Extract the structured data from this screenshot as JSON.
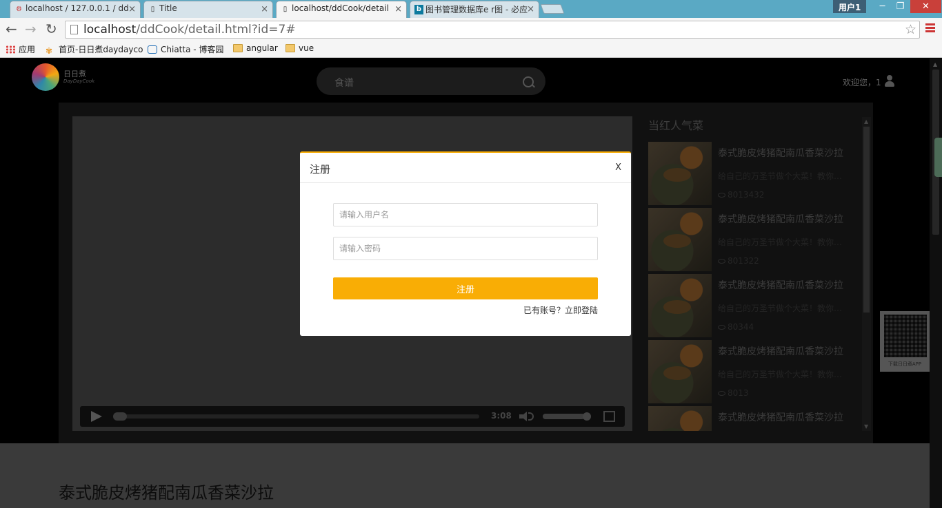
{
  "browser": {
    "tabs": [
      {
        "title": "localhost / 127.0.0.1 / dd",
        "icon": "phpmyadmin-icon"
      },
      {
        "title": "Title",
        "icon": "page-icon"
      },
      {
        "title": "localhost/ddCook/detail",
        "icon": "page-icon",
        "active": true
      },
      {
        "title": "图书管理数据库e r图 - 必应",
        "icon": "bing-icon"
      }
    ],
    "user_badge": "用户1",
    "url_host": "localhost",
    "url_path": "/ddCook/detail.html?id=7#",
    "bookmarks": [
      {
        "label": "应用",
        "icon": "apps-icon"
      },
      {
        "label": "首页-日日煮daydayco",
        "icon": "site-icon"
      },
      {
        "label": "Chiatta - 博客园",
        "icon": "site-icon"
      },
      {
        "label": "angular",
        "icon": "folder-icon"
      },
      {
        "label": "vue",
        "icon": "folder-icon"
      }
    ]
  },
  "header": {
    "logo_title": "日日煮",
    "logo_subtitle": "DayDayCook",
    "search_placeholder": "食谱",
    "welcome": "欢迎您，1"
  },
  "video": {
    "time": "3:08",
    "progress": 0.0,
    "volume": 0.85
  },
  "sidebar": {
    "title": "当红人气菜",
    "items": [
      {
        "name": "泰式脆皮烤猪配南瓜香菜沙拉",
        "desc": "给自己的万圣节做个大菜！教你如何做出泰式脆皮烤猪",
        "views": "8013432"
      },
      {
        "name": "泰式脆皮烤猪配南瓜香菜沙拉",
        "desc": "给自己的万圣节做个大菜！教你如何做出泰式脆皮烤猪",
        "views": "801322"
      },
      {
        "name": "泰式脆皮烤猪配南瓜香菜沙拉",
        "desc": "给自己的万圣节做个大菜！教你如何做出泰式脆皮烤猪",
        "views": "80344"
      },
      {
        "name": "泰式脆皮烤猪配南瓜香菜沙拉",
        "desc": "给自己的万圣节做个大菜！教你如何做出泰式脆皮烤猪",
        "views": "8013"
      },
      {
        "name": "泰式脆皮烤猪配南瓜香菜沙拉",
        "desc": "",
        "views": ""
      }
    ]
  },
  "recipe_title": "泰式脆皮烤猪配南瓜香菜沙拉",
  "qr_label": "下载日日煮APP",
  "modal": {
    "title": "注册",
    "close": "X",
    "username_placeholder": "请输入用户名",
    "password_placeholder": "请输入密码",
    "submit": "注册",
    "login_link": "已有账号？立即登陆"
  },
  "colors": {
    "accent": "#f9ad05"
  }
}
